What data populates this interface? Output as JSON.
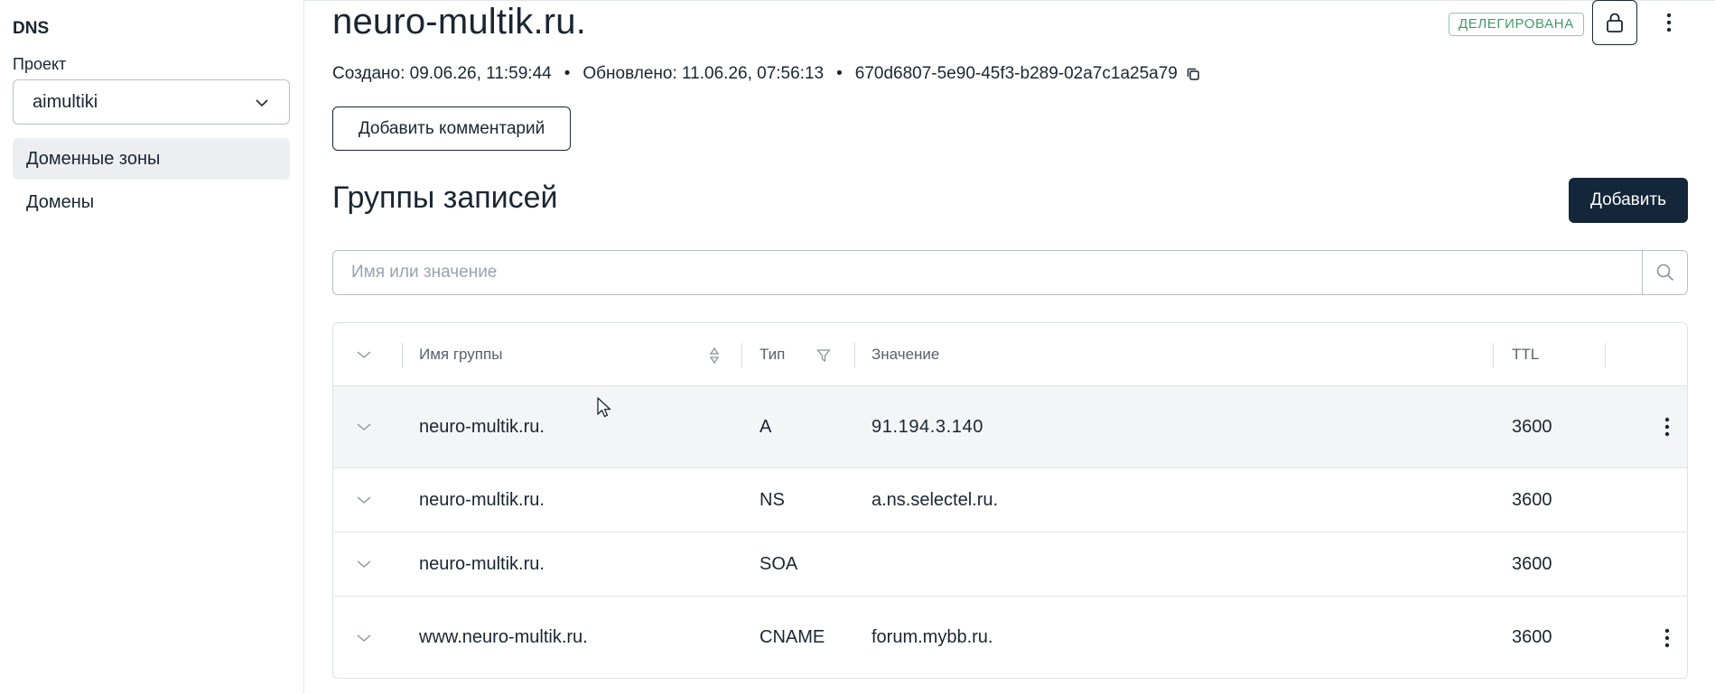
{
  "sidebar": {
    "title": "DNS",
    "project_label": "Проект",
    "project_value": "aimultiki",
    "items": [
      {
        "label": "Доменные зоны",
        "active": true
      },
      {
        "label": "Домены",
        "active": false
      }
    ]
  },
  "header": {
    "title": "neuro-multik.ru.",
    "status_badge": "ДЕЛЕГИРОВАНА",
    "lock_icon": "lock-icon",
    "more_icon": "kebab-vertical-icon"
  },
  "meta": {
    "created": "Создано: 09.06.26, 11:59:44",
    "separator": "•",
    "updated": "Обновлено: 11.06.26, 07:56:13",
    "id": "670d6807-5e90-45f3-b289-02a7c1a25a79",
    "copy_icon": "copy-icon"
  },
  "actions": {
    "add_comment": "Добавить комментарий",
    "add": "Добавить"
  },
  "section": {
    "title": "Группы записей"
  },
  "search": {
    "placeholder": "Имя или значение",
    "value": ""
  },
  "table": {
    "columns": {
      "name": "Имя группы",
      "type": "Тип",
      "value": "Значение",
      "ttl": "TTL"
    },
    "rows": [
      {
        "name": "neuro-multik.ru.",
        "type": "A",
        "value": "91.194.3.140",
        "ttl": "3600",
        "has_menu": true
      },
      {
        "name": "neuro-multik.ru.",
        "type": "NS",
        "value": "a.ns.selectel.ru.",
        "ttl": "3600",
        "has_menu": false
      },
      {
        "name": "neuro-multik.ru.",
        "type": "SOA",
        "value": "",
        "ttl": "3600",
        "has_menu": false
      },
      {
        "name": "www.neuro-multik.ru.",
        "type": "CNAME",
        "value": "forum.mybb.ru.",
        "ttl": "3600",
        "has_menu": true
      }
    ]
  },
  "colors": {
    "primary": "#14263a",
    "badge_green": "#3f9a6a",
    "active_bg": "#eceef1",
    "border": "#dfe3e7"
  }
}
